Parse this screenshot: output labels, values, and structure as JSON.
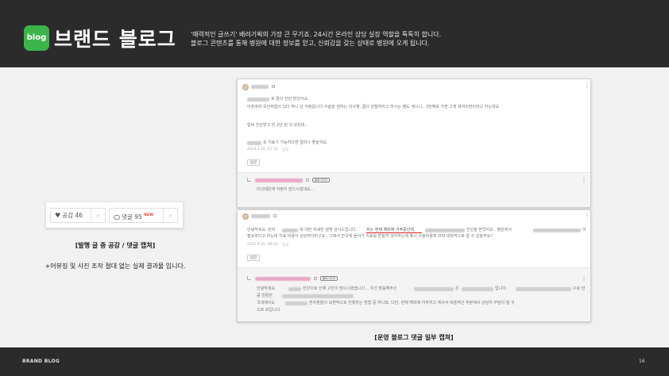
{
  "header": {
    "logo_text": "blog",
    "title": "브랜드 블로그",
    "desc_line1": "'매력적인 글쓰기' 배려기획의 가장 큰 무기죠. 24시간 온라인 상담 실장 역할을 톡톡히 합니다.",
    "desc_line2": "블로그 콘텐츠를 통해 병원에 대한 정보를 얻고, 신뢰감을 갖는 상태로 병원에 오게 됩니다."
  },
  "like_bar": {
    "like_label": "공감 46",
    "comment_label": "댓글 95",
    "new_badge": "NEW"
  },
  "left_caption": {
    "title": "[발행 글 중 공감 / 댓글 캡쳐]",
    "note": "+어뷰징 및 사진 조작 절대 없는 실제 결과물 입니다."
  },
  "comment1": {
    "line1": "로 탈이 진단 받았어요.",
    "line2": "이혼마려 유산위험이 있다 하니 넘 걱정됩니다 수술을 권하는 의사쌤, 좀더 관찰하자고 하시는 쌤도 계시니.. 3번째로 가면 그게 제자리망이라고 하는데요.",
    "line3": "벌써 진단받고 한 2년 된 것 같은데..",
    "line4": "로 치료가 가능하다면 얼마나 좋을까요.",
    "date": "2024.2.16. 01:32",
    "report": "신고",
    "reply": "답글",
    "owner_badge": "블로그주인",
    "reply_text": "미닝때문에 걱정이 많으시겠네요..."
  },
  "comment2": {
    "line1_pre": "안녕하세요. 먼저",
    "line1_mid": "에 대한 자세한 설명 감사드립니다.",
    "line1_highlight": "저는 현재 해외에 거주중인데",
    "line1_post": "진단을 받았어요.. 병원에서",
    "line1_end": "이",
    "line2": "필요하다고 하는데 치료 비용이 상당하더라구요.. 그래서 한국에 들어가 치료를 받을까 생각하는데 혹시 수술비용에 대략 대략적으로 알 수 있을까요?",
    "date": "2023.6.25. 08:15",
    "report": "신고",
    "reply": "답글",
    "owner_badge": "블로그주인",
    "reply_line1": "안녕하세요.",
    "reply_line1b": "진단으로 인해 고민이 많으시겠습니다... 우선 말씀해주신",
    "reply_line1c": "은",
    "reply_line1d": "입니다.",
    "reply_line1e": "으로 만",
    "reply_line2": "큼 번활한",
    "reply_line3": "국내에서도",
    "reply_line3b": "환자분들이 보편적으로 진행하는 방법 중 하나죠. 다만, 현재 해외에 거주하고 계셔서 비용적인 부분에서 상당히 부담이 될 것",
    "reply_line4": "으로 보입니다."
  },
  "right_caption": "[운영 블로그 댓글 일부 캡쳐]",
  "footer": {
    "brand": "BRAND BLOG",
    "page": "16"
  },
  "colors": {
    "header_bg": "#2b2b2b",
    "band_bg": "#f1f1f1",
    "logo_green": "#3cb44b",
    "highlight_red": "#e02020",
    "new_red": "#e8452c"
  }
}
